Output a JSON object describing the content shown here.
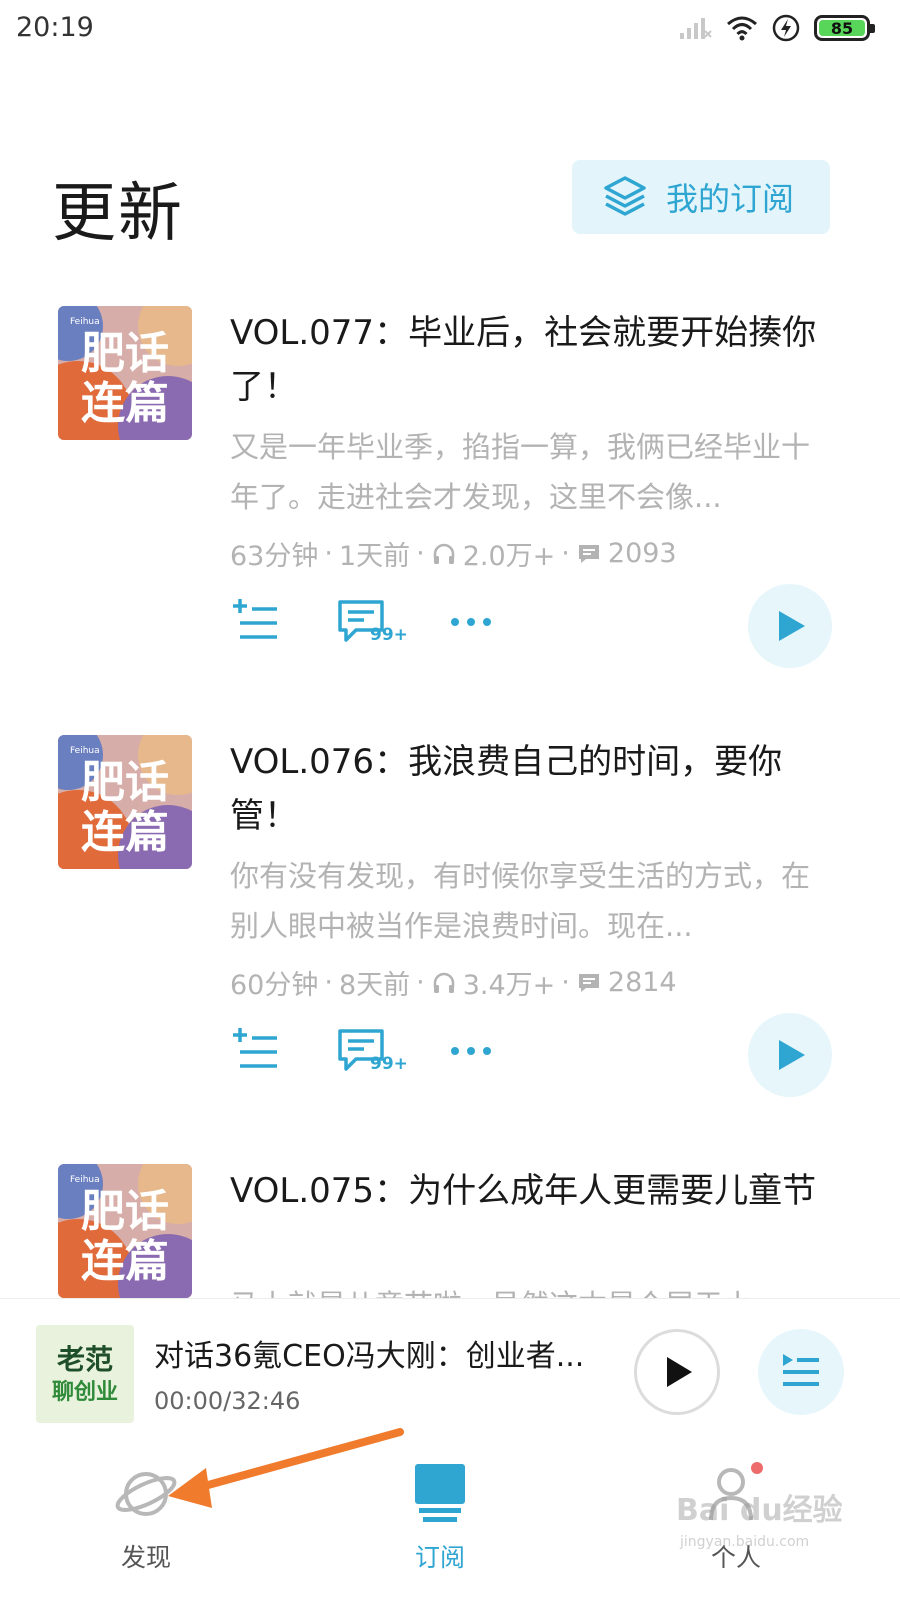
{
  "status_bar": {
    "time": "20:19",
    "battery": "85"
  },
  "header": {
    "title": "更新",
    "my_subscriptions": "我的订阅"
  },
  "cover": {
    "line1": "肥话",
    "line2": "连篇",
    "tag": "Feihua"
  },
  "episodes": [
    {
      "title": "VOL.077：毕业后，社会就要开始揍你了！",
      "description": "又是一年毕业季，掐指一算，我俩已经毕业十年了。走进社会才发现，这里不会像...",
      "duration": "63分钟",
      "age": "1天前",
      "plays": "2.0万+",
      "comments": "2093",
      "comment_badge": "99+"
    },
    {
      "title": "VOL.076：我浪费自己的时间，要你管！",
      "description": "你有没有发现，有时候你享受生活的方式，在别人眼中被当作是浪费时间。现在...",
      "duration": "60分钟",
      "age": "8天前",
      "plays": "3.4万+",
      "comments": "2814",
      "comment_badge": "99+"
    },
    {
      "title": "VOL.075：为什么成年人更需要儿童节",
      "description": "马上就是儿童节啦，虽然这本是个属于小"
    }
  ],
  "meta_separator": "·",
  "player": {
    "title": "对话36氪CEO冯大刚：创业者...",
    "time": "00:00/32:46",
    "cover_line1": "老范",
    "cover_line2": "聊创业"
  },
  "nav": {
    "discover": "发现",
    "subscribe": "订阅",
    "profile": "个人"
  },
  "watermark": {
    "brand": "Bai du经验",
    "url": "jingyan.baidu.com"
  },
  "colors": {
    "accent": "#2fa6d2",
    "arrow": "#f07b2c"
  }
}
